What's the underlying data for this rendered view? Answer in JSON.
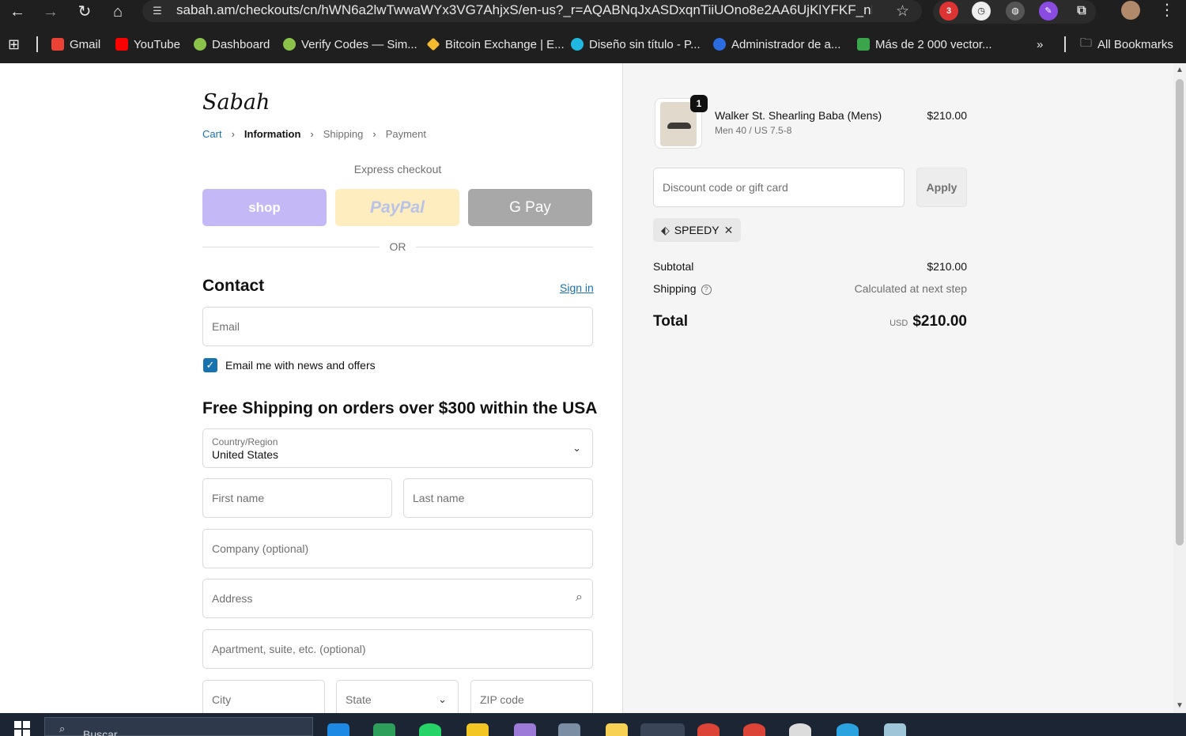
{
  "browser": {
    "url": "sabah.am/checkouts/cn/hWN6a2lwTwwaWYx3VG7AhjxS/en-us?_r=AQABNqJxASDxqnTiiUOno8e2AA6UjKlYFKF_nFpDkrw...",
    "ext_badge": "3",
    "bookmarks": [
      "Gmail",
      "YouTube",
      "Dashboard",
      "Verify Codes — Sim...",
      "Bitcoin Exchange | E...",
      "Diseño sin título - P...",
      "Administrador de a...",
      "Más de 2 000 vector..."
    ],
    "more_bookmarks": "»",
    "all_bookmarks": "All Bookmarks",
    "colors": {
      "chrome": "#1f1f1f"
    }
  },
  "store": {
    "logo": "Sabah"
  },
  "breadcrumb": {
    "cart": "Cart",
    "information": "Information",
    "shipping": "Shipping",
    "payment": "Payment"
  },
  "express": {
    "title": "Express checkout",
    "shop": "shop",
    "paypal": "PayPal",
    "gpay": "G Pay",
    "or": "OR"
  },
  "contact": {
    "heading": "Contact",
    "sign_in": "Sign in",
    "email_placeholder": "Email",
    "news_label": "Email me with news and offers",
    "news_checked": true
  },
  "shipping_form": {
    "heading": "Free Shipping on orders over $300 within the USA",
    "country_label": "Country/Region",
    "country_value": "United States",
    "first_name": "First name",
    "last_name": "Last name",
    "company": "Company (optional)",
    "address": "Address",
    "apartment": "Apartment, suite, etc. (optional)",
    "city": "City",
    "state": "State",
    "zip": "ZIP code"
  },
  "summary": {
    "product": {
      "name": "Walker St. Shearling Baba (Mens)",
      "variant": "Men 40 / US 7.5-8",
      "price": "$210.00",
      "quantity": "1"
    },
    "discount_placeholder": "Discount code or gift card",
    "apply": "Apply",
    "applied_code": "SPEEDY",
    "subtotal_label": "Subtotal",
    "subtotal_value": "$210.00",
    "shipping_label": "Shipping",
    "shipping_value": "Calculated at next step",
    "total_label": "Total",
    "total_currency": "USD",
    "total_value": "$210.00"
  },
  "taskbar": {
    "search": "Buscar"
  }
}
